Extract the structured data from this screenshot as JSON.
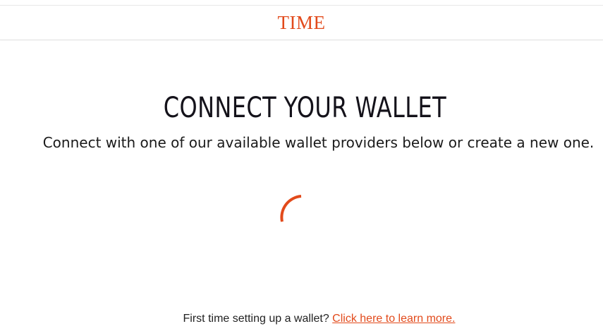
{
  "header": {
    "logo": "TIME"
  },
  "main": {
    "title": "CONNECT YOUR WALLET",
    "subtitle": "Connect with one of our available wallet providers below or create a new one.",
    "loading_indicator": "spinner"
  },
  "footer": {
    "prompt": "First time setting up a wallet?",
    "link_label": "Click here to learn more."
  },
  "colors": {
    "brand": "#e24a1b",
    "title_text": "#14121a",
    "body_text": "#1a1a1a"
  }
}
